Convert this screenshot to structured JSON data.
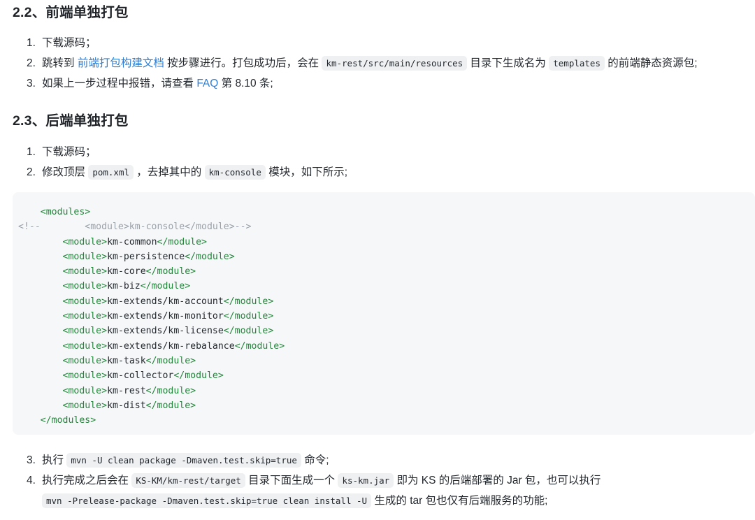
{
  "document": {
    "sections": [
      {
        "id": "2.2",
        "heading": "2.2、前端单独打包",
        "steps": [
          {
            "marker": "1.",
            "text": "下载源码；"
          },
          {
            "marker": "2.",
            "text": "跳转到 前端打包构建文档 按步骤进行。打包成功后，会在 km-rest/src/main/resources 目录下生成名为 templates 的前端静态资源包；"
          },
          {
            "marker": "3.",
            "text": "如果上一步过程中报错，请查看 FAQ 第 8.10 条;"
          }
        ]
      },
      {
        "id": "2.3",
        "heading": "2.3、后端单独打包",
        "steps": [
          {
            "marker": "1.",
            "text": "下载源码；"
          },
          {
            "marker": "2.",
            "text": "修改顶层 pom.xml ，去掉其中的 km-console 模块，如下所示；"
          },
          {
            "marker": "3.",
            "text": "执行 mvn -U clean package -Dmaven.test.skip=true 命令；"
          },
          {
            "marker": "4.",
            "text": "执行完成之后会在 KS-KM/km-rest/target 目录下面生成一个 ks-km.jar 即为 KS 的后端部署的 Jar 包，也可以执行 mvn -Prelease-package -Dmaven.test.skip=true clean install -U 生成的 tar 包也仅有后端服务的功能；"
          }
        ]
      }
    ]
  },
  "front_step1": {
    "text": "下载源码；"
  },
  "front_step2": {
    "lead": "跳转到 ",
    "link": "前端打包构建文档",
    "mid1": " 按步骤进行。打包成功后，会在 ",
    "code1": "km-rest/src/main/resources",
    "mid2": " 目录下生成名为 ",
    "code2": "templates",
    "tail": " 的前端静态资源包;"
  },
  "front_step3": {
    "lead": "如果上一步过程中报错，请查看 ",
    "link": "FAQ",
    "tail": " 第 8.10 条;"
  },
  "back_step1": {
    "text": "下载源码；"
  },
  "back_step2": {
    "lead": "修改顶层 ",
    "code1": "pom.xml",
    "mid": " ，去掉其中的 ",
    "code2": "km-console",
    "tail": " 模块，如下所示;"
  },
  "back_step3": {
    "lead": "执行 ",
    "code1": "mvn -U clean package -Dmaven.test.skip=true",
    "tail": " 命令;"
  },
  "back_step4": {
    "lead": "执行完成之后会在 ",
    "code1": "KS-KM/km-rest/target",
    "mid1": " 目录下面生成一个 ",
    "code2": "ks-km.jar",
    "mid2": " 即为 KS 的后端部署的 Jar 包，也可以执行 ",
    "code3": "mvn -Prelease-package -Dmaven.test.skip=true clean install -U",
    "tail": " 生成的 tar 包也仅有后端服务的功能;"
  },
  "markers": {
    "m1": "1.",
    "m2": "2.",
    "m3": "3.",
    "m4": "4."
  },
  "codeblock": {
    "language": "xml",
    "lines": [
      {
        "indent": "    ",
        "parts": [
          {
            "cls": "tag",
            "t": "<modules>"
          }
        ]
      },
      {
        "indent": "",
        "parts": [
          {
            "cls": "cmt",
            "t": "<!--        <module>km-console</module>-->"
          }
        ]
      },
      {
        "indent": "        ",
        "parts": [
          {
            "cls": "tag",
            "t": "<module>"
          },
          {
            "cls": "txt",
            "t": "km-common"
          },
          {
            "cls": "tag",
            "t": "</module>"
          }
        ]
      },
      {
        "indent": "        ",
        "parts": [
          {
            "cls": "tag",
            "t": "<module>"
          },
          {
            "cls": "txt",
            "t": "km-persistence"
          },
          {
            "cls": "tag",
            "t": "</module>"
          }
        ]
      },
      {
        "indent": "        ",
        "parts": [
          {
            "cls": "tag",
            "t": "<module>"
          },
          {
            "cls": "txt",
            "t": "km-core"
          },
          {
            "cls": "tag",
            "t": "</module>"
          }
        ]
      },
      {
        "indent": "        ",
        "parts": [
          {
            "cls": "tag",
            "t": "<module>"
          },
          {
            "cls": "txt",
            "t": "km-biz"
          },
          {
            "cls": "tag",
            "t": "</module>"
          }
        ]
      },
      {
        "indent": "        ",
        "parts": [
          {
            "cls": "tag",
            "t": "<module>"
          },
          {
            "cls": "txt",
            "t": "km-extends/km-account"
          },
          {
            "cls": "tag",
            "t": "</module>"
          }
        ]
      },
      {
        "indent": "        ",
        "parts": [
          {
            "cls": "tag",
            "t": "<module>"
          },
          {
            "cls": "txt",
            "t": "km-extends/km-monitor"
          },
          {
            "cls": "tag",
            "t": "</module>"
          }
        ]
      },
      {
        "indent": "        ",
        "parts": [
          {
            "cls": "tag",
            "t": "<module>"
          },
          {
            "cls": "txt",
            "t": "km-extends/km-license"
          },
          {
            "cls": "tag",
            "t": "</module>"
          }
        ]
      },
      {
        "indent": "        ",
        "parts": [
          {
            "cls": "tag",
            "t": "<module>"
          },
          {
            "cls": "txt",
            "t": "km-extends/km-rebalance"
          },
          {
            "cls": "tag",
            "t": "</module>"
          }
        ]
      },
      {
        "indent": "        ",
        "parts": [
          {
            "cls": "tag",
            "t": "<module>"
          },
          {
            "cls": "txt",
            "t": "km-task"
          },
          {
            "cls": "tag",
            "t": "</module>"
          }
        ]
      },
      {
        "indent": "        ",
        "parts": [
          {
            "cls": "tag",
            "t": "<module>"
          },
          {
            "cls": "txt",
            "t": "km-collector"
          },
          {
            "cls": "tag",
            "t": "</module>"
          }
        ]
      },
      {
        "indent": "        ",
        "parts": [
          {
            "cls": "tag",
            "t": "<module>"
          },
          {
            "cls": "txt",
            "t": "km-rest"
          },
          {
            "cls": "tag",
            "t": "</module>"
          }
        ]
      },
      {
        "indent": "        ",
        "parts": [
          {
            "cls": "tag",
            "t": "<module>"
          },
          {
            "cls": "txt",
            "t": "km-dist"
          },
          {
            "cls": "tag",
            "t": "</module>"
          }
        ]
      },
      {
        "indent": "    ",
        "parts": [
          {
            "cls": "tag",
            "t": "</modules>"
          }
        ]
      }
    ]
  },
  "colors": {
    "text": "#24292f",
    "link": "#2f7fd4",
    "code_bg": "#f6f7f9",
    "chip_bg": "#eff0f2",
    "xml_tag": "#22863a",
    "comment": "#9aa1a9"
  }
}
